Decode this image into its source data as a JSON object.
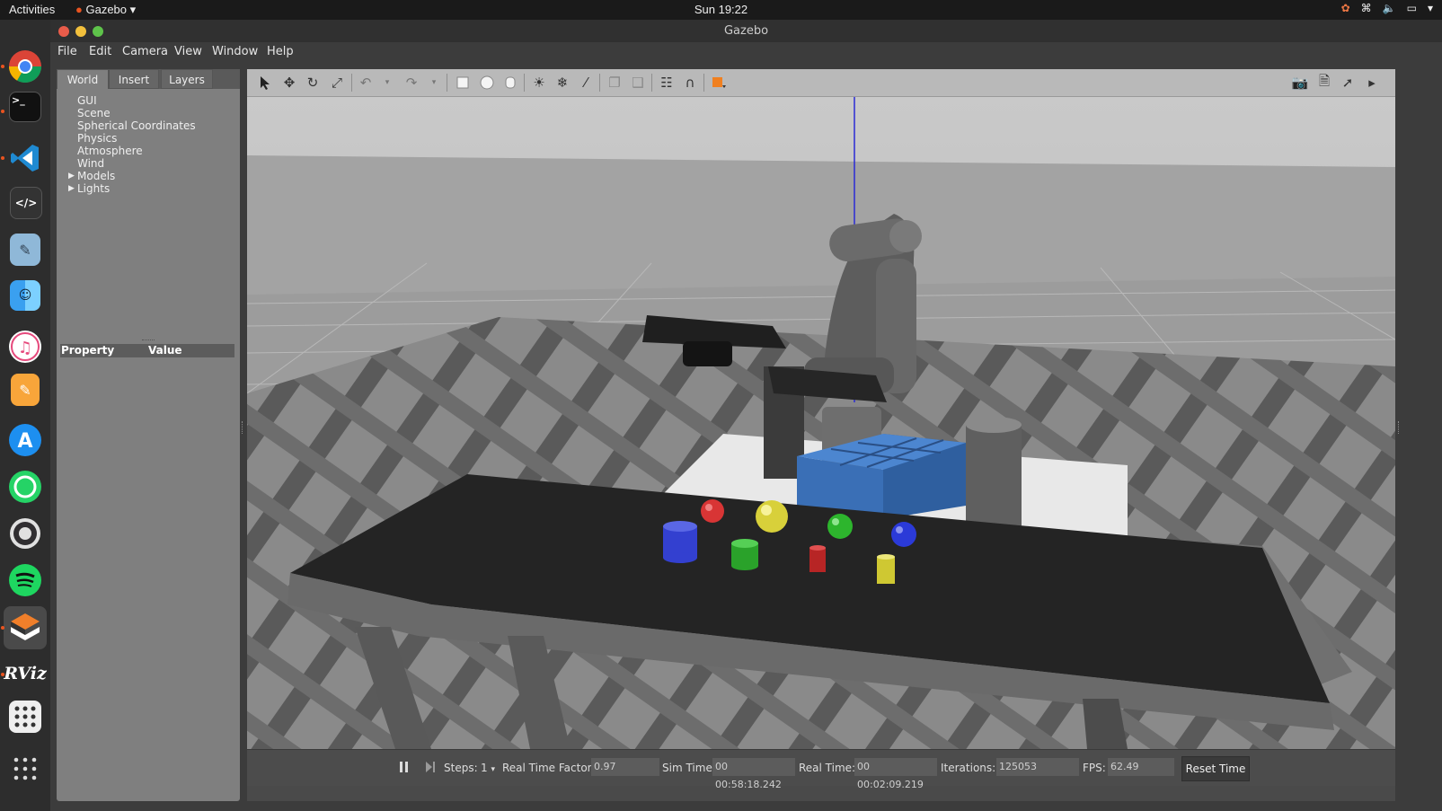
{
  "topbar": {
    "activities": "Activities",
    "app_name": "Gazebo",
    "clock": "Sun 19:22"
  },
  "window": {
    "title": "Gazebo"
  },
  "menu": {
    "file": "File",
    "edit": "Edit",
    "camera": "Camera",
    "view": "View",
    "window": "Window",
    "help": "Help"
  },
  "left_panel": {
    "tabs": [
      "World",
      "Insert",
      "Layers"
    ],
    "tree": [
      "GUI",
      "Scene",
      "Spherical Coordinates",
      "Physics",
      "Atmosphere",
      "Wind",
      "Models",
      "Lights"
    ],
    "property_header": "Property",
    "value_header": "Value"
  },
  "dock": {
    "apps": [
      "chrome-icon",
      "terminal-icon",
      "vscode-icon",
      "sublime-icon",
      "preview-icon",
      "finder-icon",
      "itunes-icon",
      "pages-icon",
      "appstore-icon",
      "whatsapp-icon",
      "obs-icon",
      "spotify-icon",
      "gazebo-icon",
      "rviz-icon",
      "launchpad-icon",
      "show-apps-icon"
    ],
    "rviz_label": "RViz"
  },
  "status": {
    "steps_label": "Steps:",
    "steps_value": "1",
    "rtf_label": "Real Time Factor:",
    "rtf_value": "0.97",
    "sim_time_label": "Sim Time:",
    "sim_time_value": "00 00:58:18.242",
    "real_time_label": "Real Time:",
    "real_time_value": "00 00:02:09.219",
    "iterations_label": "Iterations:",
    "iterations_value": "125053",
    "fps_label": "FPS:",
    "fps_value": "62.49",
    "reset_label": "Reset Time"
  },
  "colors": {
    "accent": "#e95420",
    "panel": "#7f7f7f",
    "toolbar": "#b9b9b9"
  }
}
